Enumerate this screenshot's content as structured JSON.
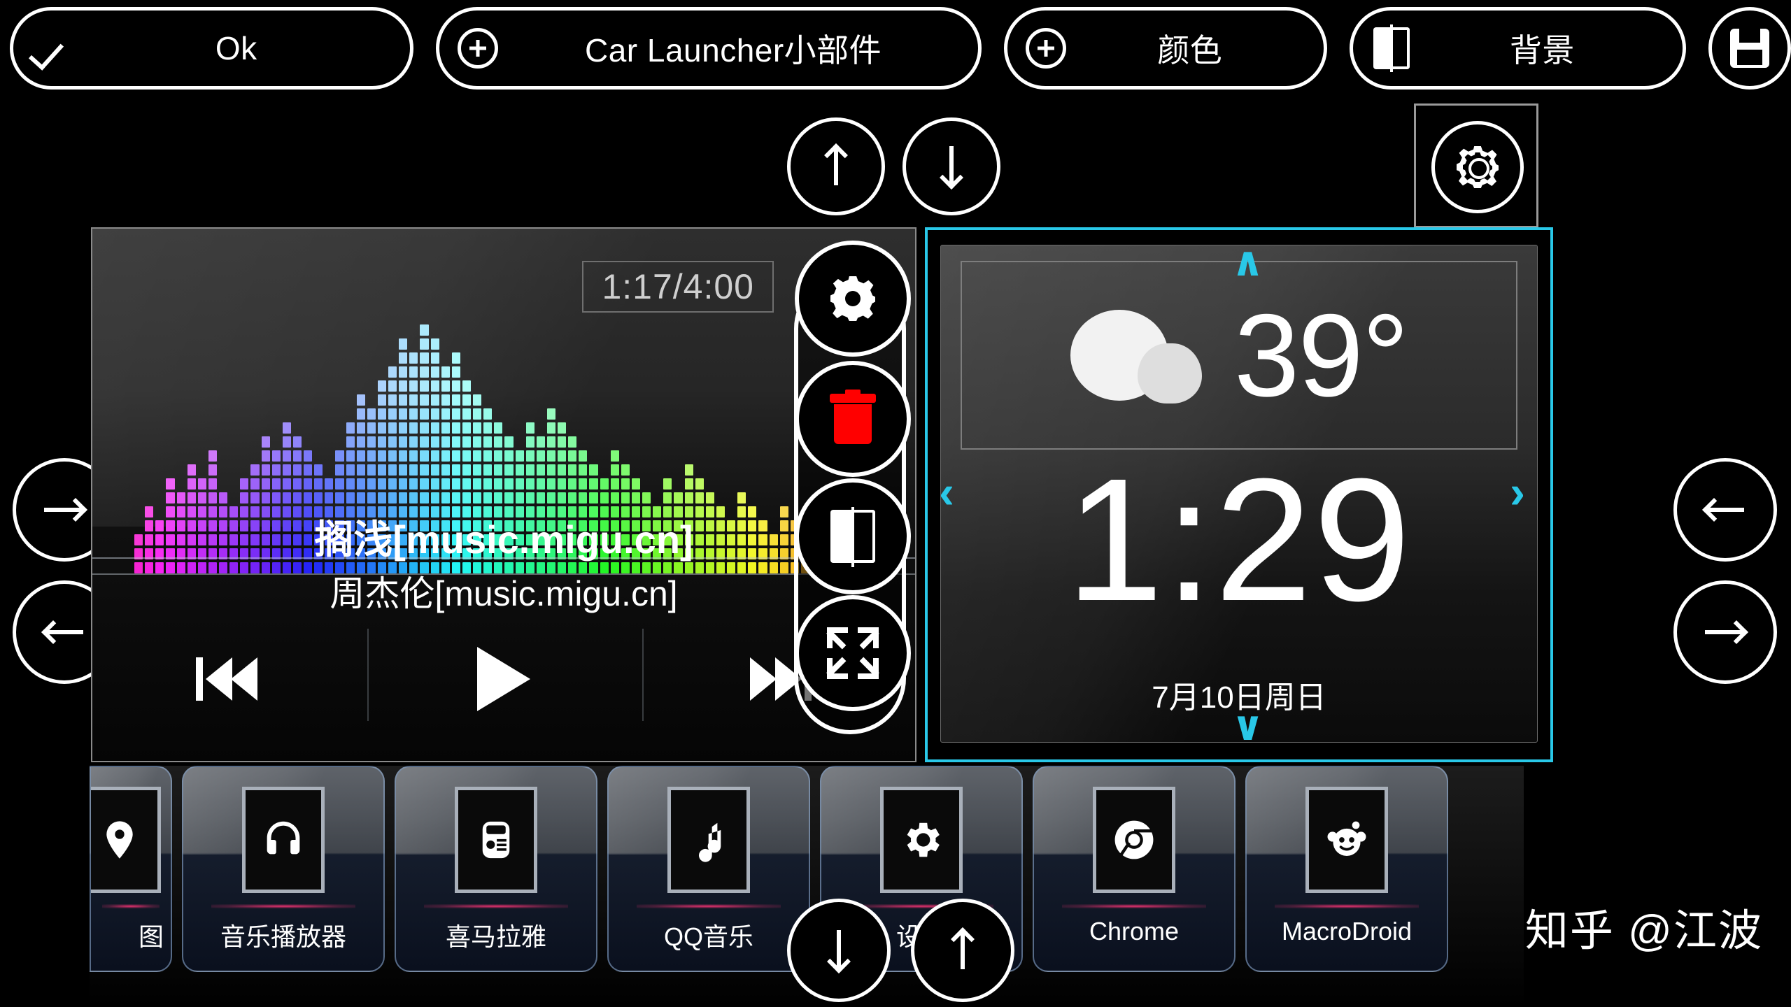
{
  "toolbar": {
    "buttons": [
      {
        "label": "Ok",
        "icon": "check-icon"
      },
      {
        "label": "Car Launcher小部件",
        "icon": "plus-circle-icon"
      },
      {
        "label": "颜色",
        "icon": "plus-circle-icon"
      },
      {
        "label": "背景",
        "icon": "contrast-icon"
      },
      {
        "label": "",
        "icon": "save-icon"
      }
    ]
  },
  "nav": {
    "move_up": "move-up-button",
    "move_down": "move-down-button",
    "page_left_top": "page-left-top",
    "page_left_bottom": "page-left-bottom",
    "page_right_top": "page-right-top",
    "page_right_bottom": "page-right-bottom",
    "settings": "settings-gear"
  },
  "music_widget": {
    "time": "1:17/4:00",
    "title": "搁浅[music.migu.cn]",
    "artist": "周杰伦[music.migu.cn]",
    "controls": {
      "previous": "previous-track",
      "play": "play",
      "next": "next-track"
    },
    "tools": [
      {
        "name": "widget-settings",
        "icon": "gear-icon"
      },
      {
        "name": "widget-delete",
        "icon": "trash-icon",
        "color": "#ff0000"
      },
      {
        "name": "widget-background",
        "icon": "contrast-icon"
      },
      {
        "name": "widget-resize",
        "icon": "expand-arrows-icon"
      }
    ]
  },
  "clock_widget": {
    "temperature": "39°",
    "weather_icon": "cloud-icon",
    "time": "1:29",
    "date": "7月10日周日",
    "chevron_up": "∧",
    "chevron_down": "∨",
    "chevron_left": "‹",
    "chevron_right": "›",
    "selection_color": "#29c8e8"
  },
  "dock": {
    "apps": [
      {
        "label": "图",
        "icon": "map-icon",
        "partial": true
      },
      {
        "label": "音乐播放器",
        "icon": "headphones-icon",
        "partial": false
      },
      {
        "label": "喜马拉雅",
        "icon": "radio-icon",
        "partial": false
      },
      {
        "label": "QQ音乐",
        "icon": "music-note-icon",
        "partial": false
      },
      {
        "label": "设置",
        "icon": "gear-icon",
        "partial": false
      },
      {
        "label": "Chrome",
        "icon": "chrome-icon",
        "partial": false
      },
      {
        "label": "MacroDroid",
        "icon": "droid-face-icon",
        "partial": false
      }
    ],
    "scroll_down": "dock-scroll-down",
    "scroll_up": "dock-scroll-up"
  },
  "watermark": "知乎 @江波"
}
